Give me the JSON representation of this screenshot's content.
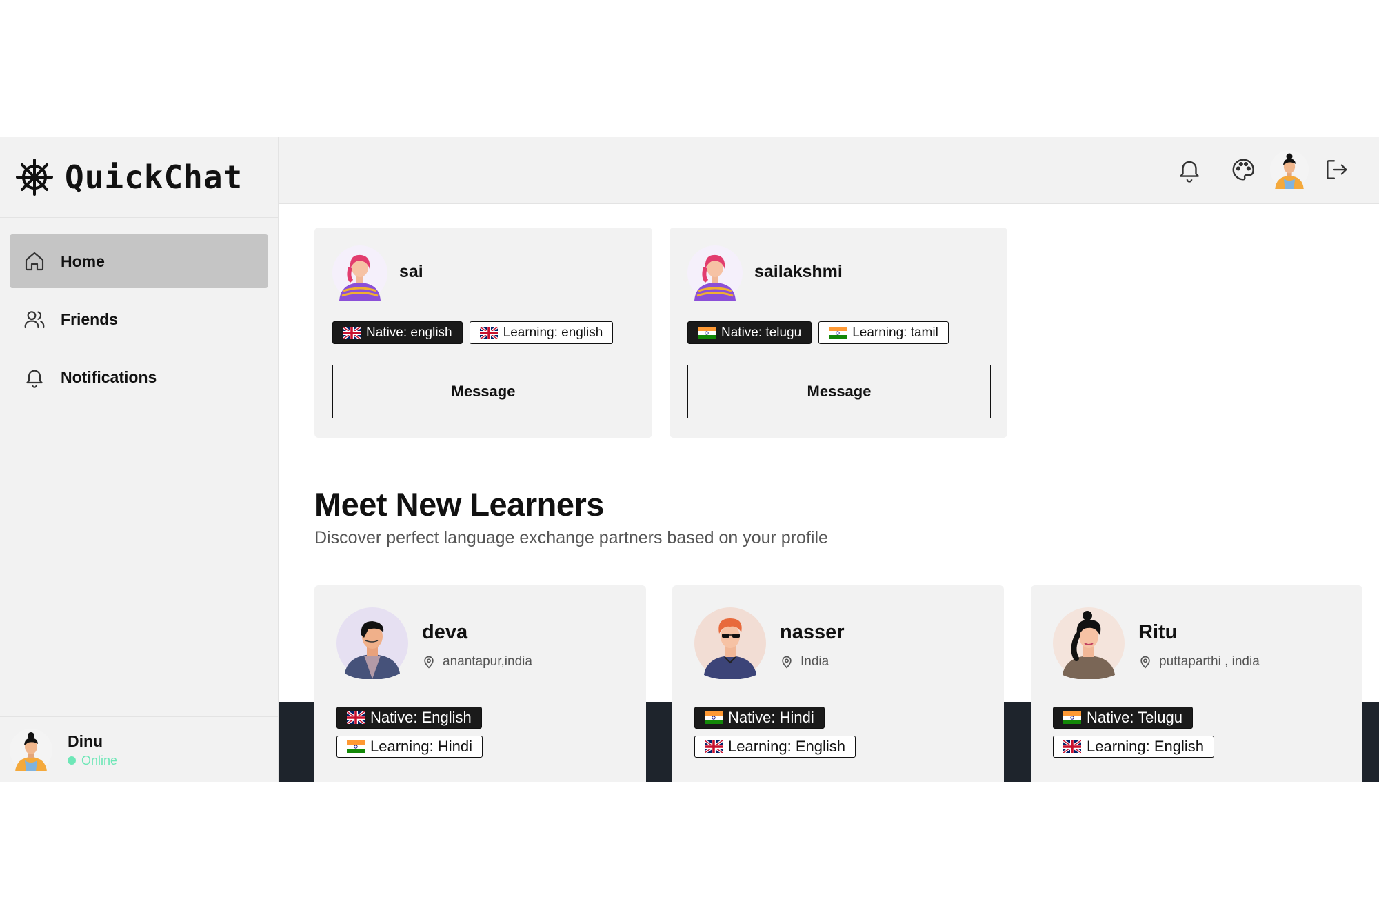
{
  "app": {
    "brand": "QuickChat"
  },
  "sidebar": {
    "items": [
      {
        "label": "Home",
        "icon": "home-icon",
        "active": true
      },
      {
        "label": "Friends",
        "icon": "users-icon",
        "active": false
      },
      {
        "label": "Notifications",
        "icon": "bell-icon",
        "active": false
      }
    ],
    "user": {
      "name": "Dinu",
      "status": "Online"
    }
  },
  "header": {
    "icons": [
      "bell-icon",
      "palette-icon",
      "avatar",
      "logout-icon"
    ]
  },
  "friends": [
    {
      "name": "sai",
      "native": "Native: english",
      "learning": "Learning: english",
      "native_flag": "uk",
      "learning_flag": "uk",
      "button": "Message"
    },
    {
      "name": "sailakshmi",
      "native": "Native: telugu",
      "learning": "Learning: tamil",
      "native_flag": "india",
      "learning_flag": "india",
      "button": "Message"
    }
  ],
  "learners_section": {
    "title": "Meet New Learners",
    "subtitle": "Discover perfect language exchange partners based on your profile"
  },
  "learners": [
    {
      "name": "deva",
      "location": "anantapur,india",
      "native": "Native: English",
      "learning": "Learning: Hindi",
      "native_flag": "uk",
      "learning_flag": "india"
    },
    {
      "name": "nasser",
      "location": "India",
      "native": "Native: Hindi",
      "learning": "Learning: English",
      "native_flag": "india",
      "learning_flag": "uk"
    },
    {
      "name": "Ritu",
      "location": "puttaparthi , india",
      "native": "Native: Telugu",
      "learning": "Learning: English",
      "native_flag": "india",
      "learning_flag": "uk"
    }
  ],
  "colors": {
    "online": "#6ee7b7",
    "sidebar_bg": "#f2f2f2",
    "active_nav": "#c5c5c5",
    "dark_strip": "#1e242c"
  }
}
